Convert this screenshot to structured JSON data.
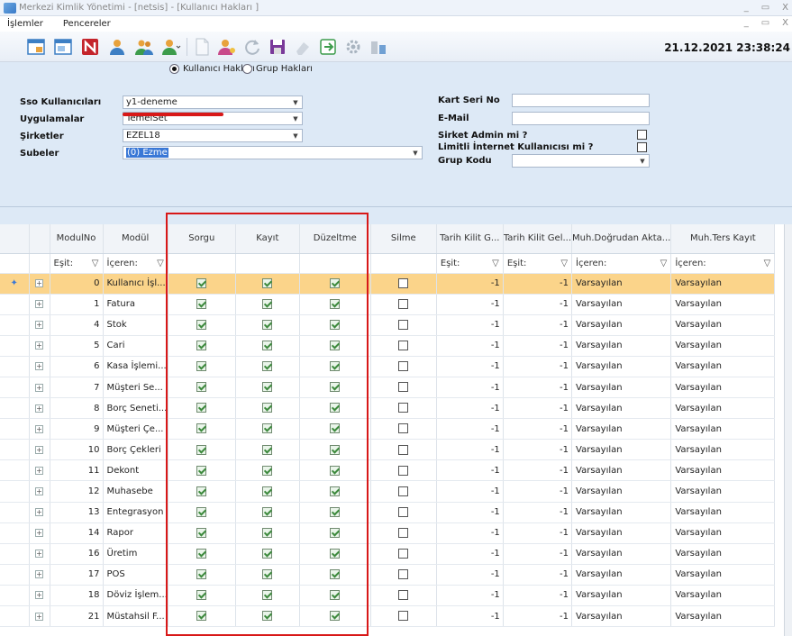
{
  "window": {
    "title": "Merkezi Kimlik Yönetimi - [netsis] - [Kullanıcı Hakları ]",
    "controls": [
      "_",
      "▭",
      "X"
    ]
  },
  "menu": {
    "items": [
      "İşlemler",
      "Pencereler"
    ],
    "controls": [
      "_",
      "▭",
      "X"
    ]
  },
  "toolbar": {
    "datetime": "21.12.2021 23:38:24"
  },
  "form": {
    "radio_user": "Kullanıcı Hakları",
    "radio_group": "Grup Hakları",
    "sso_label": "Sso Kullanıcıları",
    "sso_value": "y1-deneme",
    "app_label": "Uygulamalar",
    "app_value": "TemelSet",
    "company_label": "Şirketler",
    "company_value": "EZEL18",
    "branch_label": "Subeler",
    "branch_value": "(0) Ezme",
    "card_label": "Kart Seri No",
    "card_value": "",
    "email_label": "E-Mail",
    "email_value": "",
    "admin_label": "Sirket Admin mi ?",
    "internet_label": "Limitli İnternet Kullanıcısı mi ?",
    "group_label": "Grup Kodu",
    "group_value": ""
  },
  "grid": {
    "columns": [
      "ModulNo",
      "Modül",
      "Sorgu",
      "Kayıt",
      "Düzeltme",
      "Silme",
      "Tarih Kilit G...",
      "Tarih Kilit Gel...",
      "Muh.Doğrudan Akta...",
      "Muh.Ters Kayıt"
    ],
    "filter": {
      "modulno": "Eşit:",
      "modul": "İçeren:",
      "tarih1": "Eşit:",
      "tarih2": "Eşit:",
      "muh1": "İçeren:",
      "muh2": "İçeren:"
    },
    "rows": [
      {
        "no": "0",
        "name": "Kullanıcı İşl...",
        "t1": "-1",
        "t2": "-1",
        "m1": "Varsayılan",
        "m2": "Varsayılan"
      },
      {
        "no": "1",
        "name": "Fatura",
        "t1": "-1",
        "t2": "-1",
        "m1": "Varsayılan",
        "m2": "Varsayılan"
      },
      {
        "no": "4",
        "name": "Stok",
        "t1": "-1",
        "t2": "-1",
        "m1": "Varsayılan",
        "m2": "Varsayılan"
      },
      {
        "no": "5",
        "name": "Cari",
        "t1": "-1",
        "t2": "-1",
        "m1": "Varsayılan",
        "m2": "Varsayılan"
      },
      {
        "no": "6",
        "name": "Kasa İşlemi...",
        "t1": "-1",
        "t2": "-1",
        "m1": "Varsayılan",
        "m2": "Varsayılan"
      },
      {
        "no": "7",
        "name": "Müşteri Se...",
        "t1": "-1",
        "t2": "-1",
        "m1": "Varsayılan",
        "m2": "Varsayılan"
      },
      {
        "no": "8",
        "name": "Borç Seneti...",
        "t1": "-1",
        "t2": "-1",
        "m1": "Varsayılan",
        "m2": "Varsayılan"
      },
      {
        "no": "9",
        "name": "Müşteri Çe...",
        "t1": "-1",
        "t2": "-1",
        "m1": "Varsayılan",
        "m2": "Varsayılan"
      },
      {
        "no": "10",
        "name": "Borç Çekleri",
        "t1": "-1",
        "t2": "-1",
        "m1": "Varsayılan",
        "m2": "Varsayılan"
      },
      {
        "no": "11",
        "name": "Dekont",
        "t1": "-1",
        "t2": "-1",
        "m1": "Varsayılan",
        "m2": "Varsayılan"
      },
      {
        "no": "12",
        "name": "Muhasebe",
        "t1": "-1",
        "t2": "-1",
        "m1": "Varsayılan",
        "m2": "Varsayılan"
      },
      {
        "no": "13",
        "name": "Entegrasyon",
        "t1": "-1",
        "t2": "-1",
        "m1": "Varsayılan",
        "m2": "Varsayılan"
      },
      {
        "no": "14",
        "name": "Rapor",
        "t1": "-1",
        "t2": "-1",
        "m1": "Varsayılan",
        "m2": "Varsayılan"
      },
      {
        "no": "16",
        "name": "Üretim",
        "t1": "-1",
        "t2": "-1",
        "m1": "Varsayılan",
        "m2": "Varsayılan"
      },
      {
        "no": "17",
        "name": "POS",
        "t1": "-1",
        "t2": "-1",
        "m1": "Varsayılan",
        "m2": "Varsayılan"
      },
      {
        "no": "18",
        "name": "Döviz İşlem...",
        "t1": "-1",
        "t2": "-1",
        "m1": "Varsayılan",
        "m2": "Varsayılan"
      },
      {
        "no": "21",
        "name": "Müstahsil F...",
        "t1": "-1",
        "t2": "-1",
        "m1": "Varsayılan",
        "m2": "Varsayılan"
      }
    ]
  }
}
